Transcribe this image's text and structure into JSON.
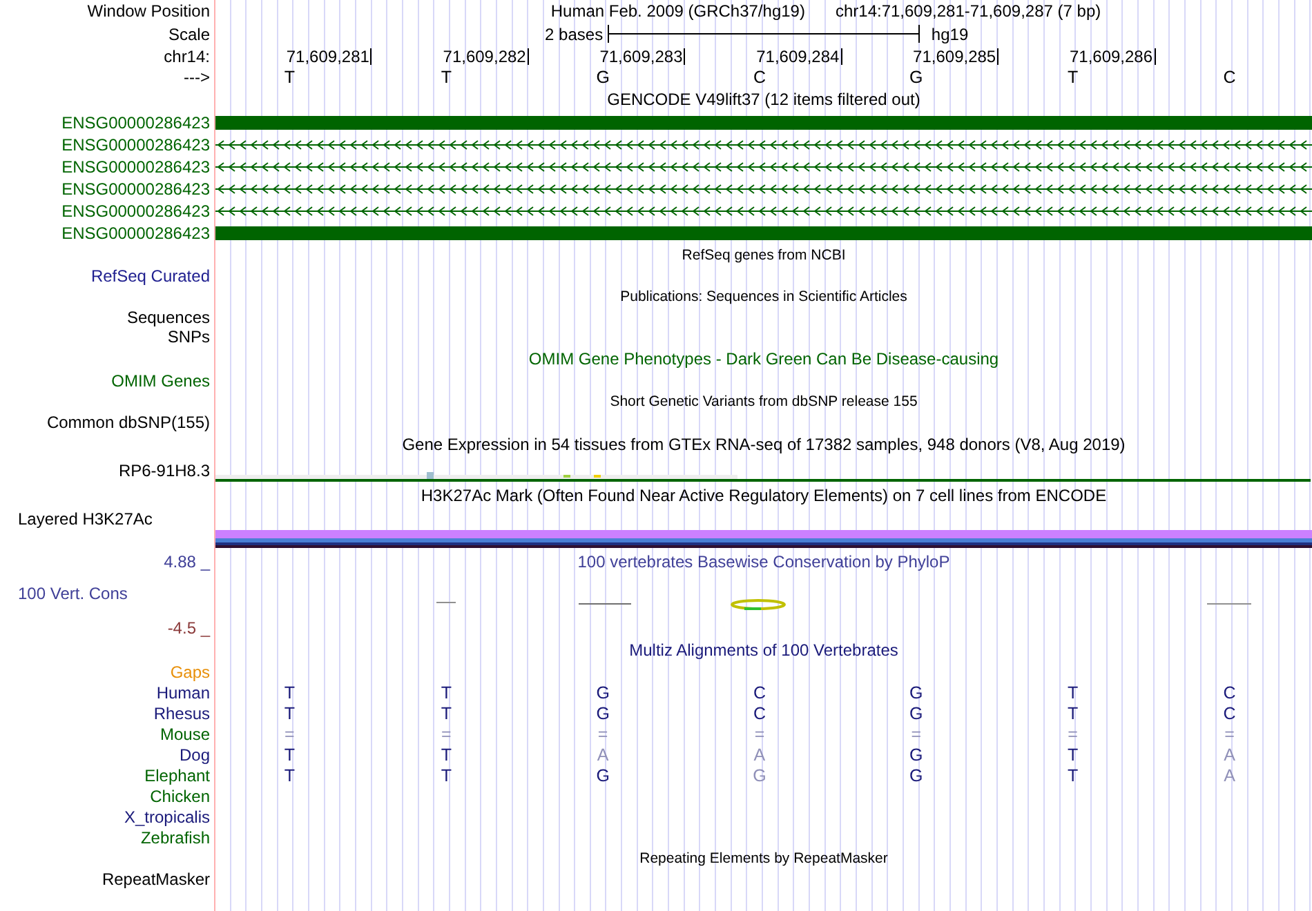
{
  "header": {
    "label": "Window Position",
    "title": "Human Feb. 2009 (GRCh37/hg19)",
    "position": "chr14:71,609,281-71,609,287 (7 bp)"
  },
  "scale": {
    "label": "Scale",
    "length": "2 bases",
    "assembly": "hg19"
  },
  "ruler": {
    "label": "chr14:",
    "positions": [
      "71,609,281",
      "71,609,282",
      "71,609,283",
      "71,609,284",
      "71,609,285",
      "71,609,286"
    ]
  },
  "sequence": {
    "label": "--->",
    "bases": [
      "T",
      "T",
      "G",
      "C",
      "G",
      "T",
      "C"
    ]
  },
  "tracks": [
    {
      "kind": "title",
      "text": "GENCODE V49lift37 (12 items filtered out)",
      "color": "#000000"
    },
    {
      "kind": "gene-bar",
      "label": "ENSG00000286423",
      "color": "#006400"
    },
    {
      "kind": "gene-arrows",
      "label": "ENSG00000286423",
      "color": "#006400"
    },
    {
      "kind": "gene-arrows",
      "label": "ENSG00000286423",
      "color": "#006400"
    },
    {
      "kind": "gene-arrows",
      "label": "ENSG00000286423",
      "color": "#006400"
    },
    {
      "kind": "gene-arrows",
      "label": "ENSG00000286423",
      "color": "#006400"
    },
    {
      "kind": "gene-bar",
      "label": "ENSG00000286423",
      "color": "#006400"
    },
    {
      "kind": "subtitle",
      "text": "RefSeq genes from NCBI",
      "color": "#000000"
    },
    {
      "kind": "label",
      "label": "RefSeq Curated",
      "color": "#202090"
    },
    {
      "kind": "subtitle",
      "text": "Publications: Sequences in Scientific Articles",
      "color": "#000000"
    },
    {
      "kind": "label",
      "label": "Sequences",
      "color": "#000000"
    },
    {
      "kind": "label",
      "label": "SNPs",
      "color": "#000000"
    },
    {
      "kind": "title",
      "text": "OMIM Gene Phenotypes - Dark Green Can Be Disease-causing",
      "color": "#006400"
    },
    {
      "kind": "label",
      "label": "OMIM Genes",
      "color": "#006400"
    },
    {
      "kind": "subtitle",
      "text": "Short Genetic Variants from dbSNP release 155",
      "color": "#000000"
    },
    {
      "kind": "label",
      "label": "Common dbSNP(155)",
      "color": "#000000"
    },
    {
      "kind": "title",
      "text": "Gene Expression in 54 tissues from GTEx RNA-seq of 17382 samples, 948 donors (V8, Aug 2019)",
      "color": "#000000"
    },
    {
      "kind": "expression",
      "label": "RP6-91H8.3",
      "color": "#000000"
    },
    {
      "kind": "title",
      "text": "H3K27Ac Mark (Often Found Near Active Regulatory Elements) on 7 cell lines from ENCODE",
      "color": "#000000"
    },
    {
      "kind": "group-label",
      "label": "Layered H3K27Ac",
      "color": "#000000"
    },
    {
      "kind": "signal-bars"
    },
    {
      "kind": "scale-top",
      "label": "4.88 _",
      "text": "100 vertebrates Basewise Conservation by PhyloP",
      "color": "#404098"
    },
    {
      "kind": "conservation",
      "label": "100 Vert. Cons",
      "color": "#404098"
    },
    {
      "kind": "label",
      "label": "-4.5 _",
      "color": "#8b3a3a"
    },
    {
      "kind": "title",
      "text": "Multiz Alignments of 100 Vertebrates",
      "color": "#1a1a7a"
    },
    {
      "kind": "label",
      "label": "Gaps",
      "color": "#e8900a"
    },
    {
      "kind": "alignment",
      "label": "Human",
      "color": "#1a1a7a",
      "bases": [
        {
          "base": "T",
          "match": true
        },
        {
          "base": "T",
          "match": true
        },
        {
          "base": "G",
          "match": true
        },
        {
          "base": "C",
          "match": true
        },
        {
          "base": "G",
          "match": true
        },
        {
          "base": "T",
          "match": true
        },
        {
          "base": "C",
          "match": true
        }
      ]
    },
    {
      "kind": "alignment",
      "label": "Rhesus",
      "color": "#1a1a7a",
      "bases": [
        {
          "base": "T",
          "match": true
        },
        {
          "base": "T",
          "match": true
        },
        {
          "base": "G",
          "match": true
        },
        {
          "base": "C",
          "match": true
        },
        {
          "base": "G",
          "match": true
        },
        {
          "base": "T",
          "match": true
        },
        {
          "base": "C",
          "match": true
        }
      ]
    },
    {
      "kind": "alignment",
      "label": "Mouse",
      "color": "#006400",
      "bases": [
        {
          "base": "=",
          "match": false
        },
        {
          "base": "=",
          "match": false
        },
        {
          "base": "=",
          "match": false
        },
        {
          "base": "=",
          "match": false
        },
        {
          "base": "=",
          "match": false
        },
        {
          "base": "=",
          "match": false
        },
        {
          "base": "=",
          "match": false
        }
      ]
    },
    {
      "kind": "alignment",
      "label": "Dog",
      "color": "#1a1a7a",
      "bases": [
        {
          "base": "T",
          "match": true
        },
        {
          "base": "T",
          "match": true
        },
        {
          "base": "A",
          "match": false
        },
        {
          "base": "A",
          "match": false
        },
        {
          "base": "G",
          "match": true
        },
        {
          "base": "T",
          "match": true
        },
        {
          "base": "A",
          "match": false
        }
      ]
    },
    {
      "kind": "alignment",
      "label": "Elephant",
      "color": "#006400",
      "bases": [
        {
          "base": "T",
          "match": true
        },
        {
          "base": "T",
          "match": true
        },
        {
          "base": "G",
          "match": true
        },
        {
          "base": "G",
          "match": false
        },
        {
          "base": "G",
          "match": true
        },
        {
          "base": "T",
          "match": true
        },
        {
          "base": "A",
          "match": false
        }
      ]
    },
    {
      "kind": "alignment",
      "label": "Chicken",
      "color": "#006400"
    },
    {
      "kind": "alignment",
      "label": "X_tropicalis",
      "color": "#1a1a7a"
    },
    {
      "kind": "alignment",
      "label": "Zebrafish",
      "color": "#006400"
    },
    {
      "kind": "subtitle",
      "text": "Repeating Elements by RepeatMasker",
      "color": "#000000"
    },
    {
      "kind": "label",
      "label": "RepeatMasker",
      "color": "#000000"
    }
  ]
}
